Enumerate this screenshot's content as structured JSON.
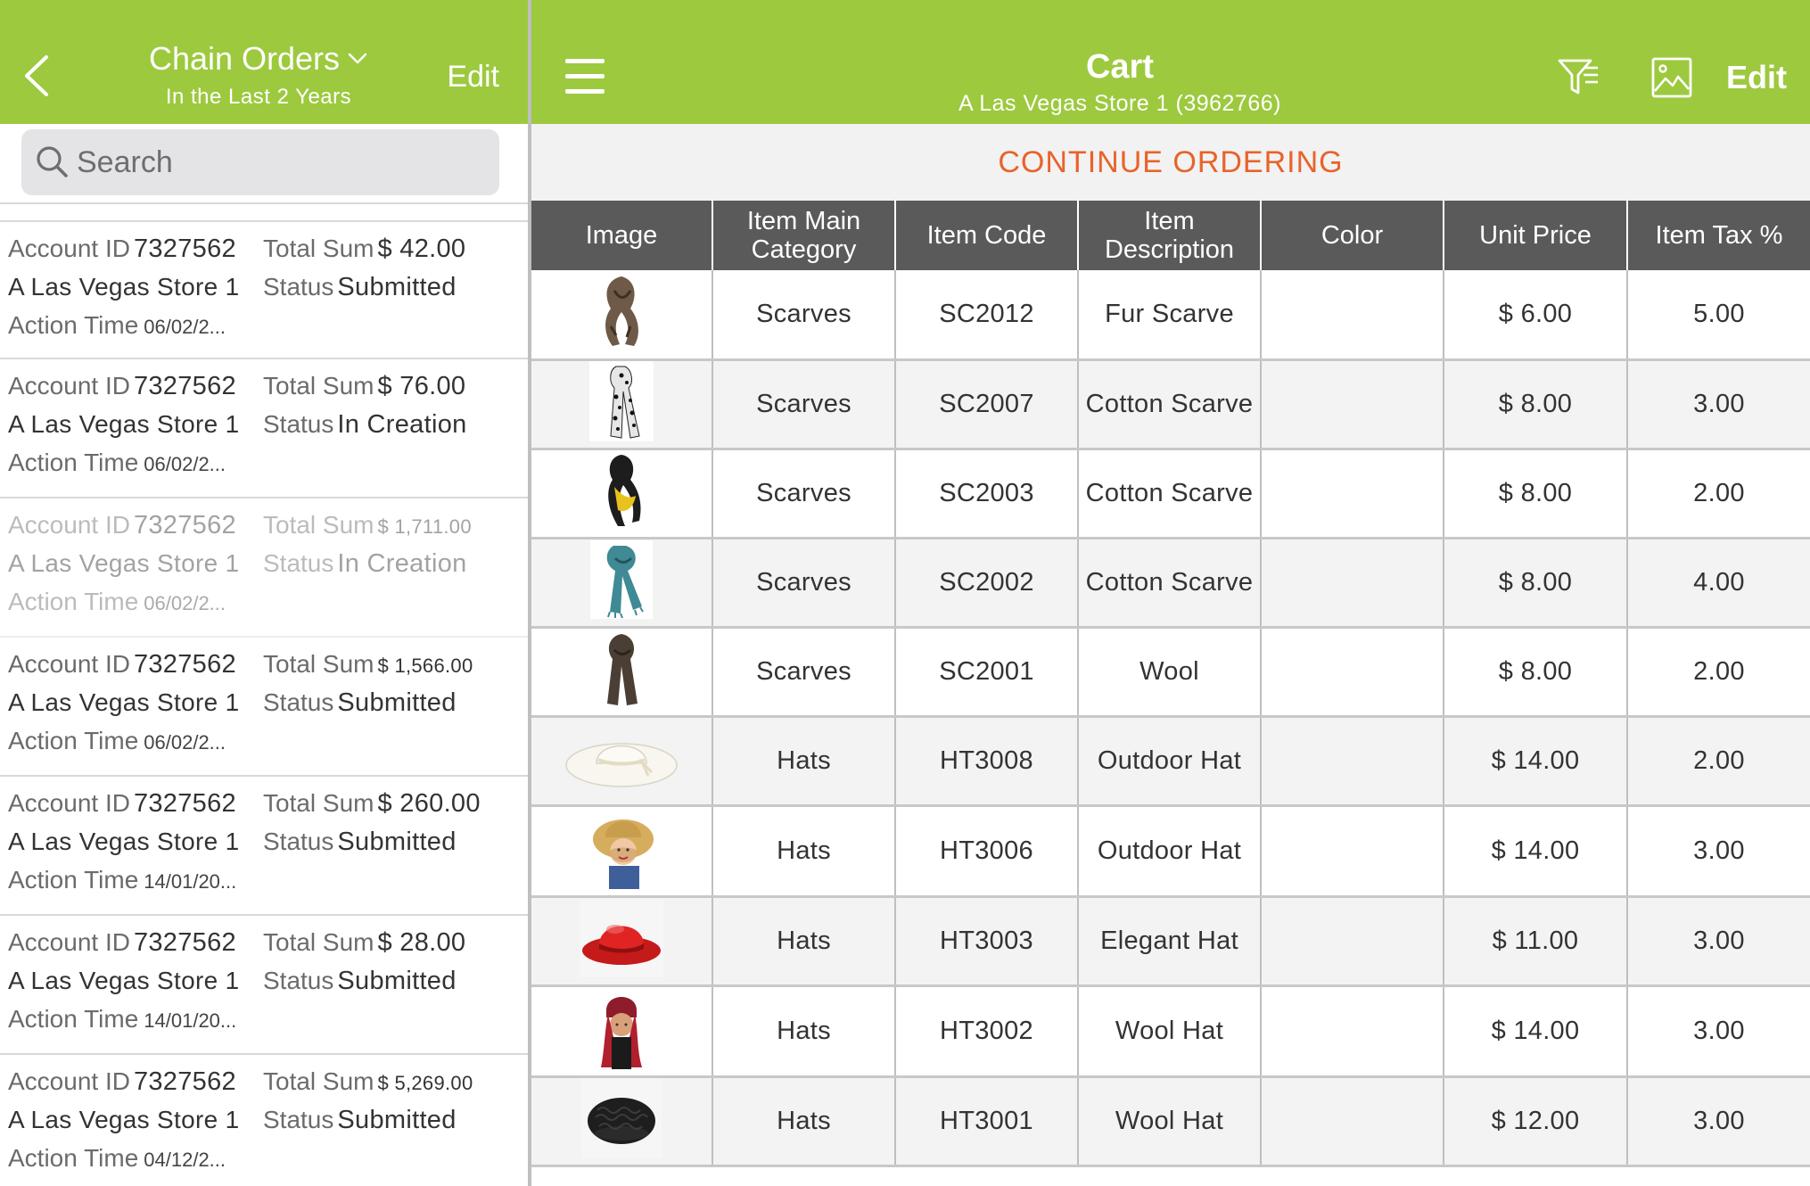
{
  "left_panel": {
    "header": {
      "title": "Chain Orders",
      "subtitle": "In the Last 2 Years",
      "edit_label": "Edit"
    },
    "search": {
      "placeholder": "Search"
    },
    "orders": [
      {
        "account_label": "Account ID",
        "account_id": "7327562",
        "total_label": "Total Sum",
        "total": "$ 42.00",
        "store": "A Las Vegas Store 1",
        "status_label": "Status",
        "status": "Submitted",
        "time_label": "Action Time",
        "time": "06/02/2...",
        "dimmed": false
      },
      {
        "account_label": "Account ID",
        "account_id": "7327562",
        "total_label": "Total Sum",
        "total": "$ 76.00",
        "store": "A Las Vegas Store 1",
        "status_label": "Status",
        "status": "In Creation",
        "time_label": "Action Time",
        "time": "06/02/2...",
        "dimmed": false
      },
      {
        "account_label": "Account ID",
        "account_id": "7327562",
        "total_label": "Total Sum",
        "total": "$ 1,711.00",
        "store": "A Las Vegas Store 1",
        "status_label": "Status",
        "status": "In Creation",
        "time_label": "Action Time",
        "time": "06/02/2...",
        "dimmed": true
      },
      {
        "account_label": "Account ID",
        "account_id": "7327562",
        "total_label": "Total Sum",
        "total": "$ 1,566.00",
        "store": "A Las Vegas Store 1",
        "status_label": "Status",
        "status": "Submitted",
        "time_label": "Action Time",
        "time": "06/02/2...",
        "dimmed": false
      },
      {
        "account_label": "Account ID",
        "account_id": "7327562",
        "total_label": "Total Sum",
        "total": "$ 260.00",
        "store": "A Las Vegas Store 1",
        "status_label": "Status",
        "status": "Submitted",
        "time_label": "Action Time",
        "time": "14/01/20...",
        "dimmed": false
      },
      {
        "account_label": "Account ID",
        "account_id": "7327562",
        "total_label": "Total Sum",
        "total": "$ 28.00",
        "store": "A Las Vegas Store 1",
        "status_label": "Status",
        "status": "Submitted",
        "time_label": "Action Time",
        "time": "14/01/20...",
        "dimmed": false
      },
      {
        "account_label": "Account ID",
        "account_id": "7327562",
        "total_label": "Total Sum",
        "total": "$ 5,269.00",
        "store": "A Las Vegas Store 1",
        "status_label": "Status",
        "status": "Submitted",
        "time_label": "Action Time",
        "time": "04/12/2...",
        "dimmed": false
      }
    ]
  },
  "right_panel": {
    "header": {
      "title": "Cart",
      "subtitle": "A Las Vegas Store 1 (3962766)",
      "edit_label": "Edit",
      "icons": [
        "menu-icon",
        "filter-icon",
        "image-icon"
      ]
    },
    "continue_label": "CONTINUE ORDERING",
    "table": {
      "columns": [
        "Image",
        "Item Main Category",
        "Item Code",
        "Item Description",
        "Color",
        "Unit Price",
        "Item Tax %"
      ],
      "rows": [
        {
          "image": "fur-scarf-image",
          "category": "Scarves",
          "code": "SC2012",
          "description": "Fur Scarve",
          "color": "",
          "price": "$ 6.00",
          "tax": "5.00"
        },
        {
          "image": "leopard-scarf-image",
          "category": "Scarves",
          "code": "SC2007",
          "description": "Cotton Scarve",
          "color": "",
          "price": "$ 8.00",
          "tax": "3.00"
        },
        {
          "image": "yellow-scarf-image",
          "category": "Scarves",
          "code": "SC2003",
          "description": "Cotton Scarve",
          "color": "",
          "price": "$ 8.00",
          "tax": "2.00"
        },
        {
          "image": "teal-scarf-image",
          "category": "Scarves",
          "code": "SC2002",
          "description": "Cotton Scarve",
          "color": "",
          "price": "$ 8.00",
          "tax": "4.00"
        },
        {
          "image": "brown-wool-scarf-image",
          "category": "Scarves",
          "code": "SC2001",
          "description": "Wool",
          "color": "",
          "price": "$ 8.00",
          "tax": "2.00"
        },
        {
          "image": "white-sun-hat-image",
          "category": "Hats",
          "code": "HT3008",
          "description": "Outdoor Hat",
          "color": "",
          "price": "$ 14.00",
          "tax": "2.00"
        },
        {
          "image": "straw-hat-girl-image",
          "category": "Hats",
          "code": "HT3006",
          "description": "Outdoor Hat",
          "color": "",
          "price": "$ 14.00",
          "tax": "3.00"
        },
        {
          "image": "red-bowler-hat-image",
          "category": "Hats",
          "code": "HT3003",
          "description": "Elegant Hat",
          "color": "",
          "price": "$ 11.00",
          "tax": "3.00"
        },
        {
          "image": "red-wool-hat-woman-image",
          "category": "Hats",
          "code": "HT3002",
          "description": "Wool Hat",
          "color": "",
          "price": "$ 14.00",
          "tax": "3.00"
        },
        {
          "image": "black-knit-beret-image",
          "category": "Hats",
          "code": "HT3001",
          "description": "Wool Hat",
          "color": "",
          "price": "$ 12.00",
          "tax": "3.00"
        }
      ]
    }
  },
  "colors": {
    "header_green": "#9dc93e",
    "accent_orange": "#e8632a",
    "table_header": "#5a5a5a"
  }
}
